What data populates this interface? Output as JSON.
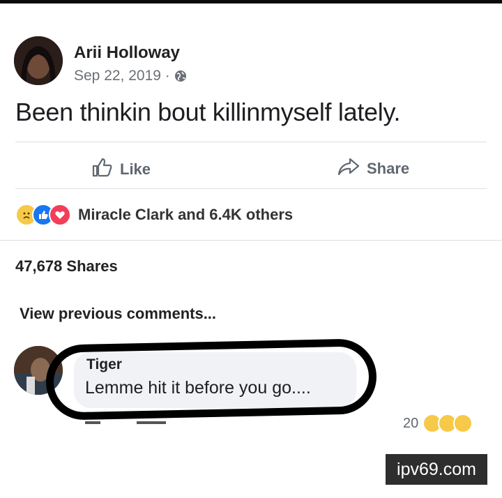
{
  "post": {
    "author": "Arii Holloway",
    "date": "Sep 22, 2019 ·",
    "privacy_icon": "globe-icon",
    "text": "Been thinkin bout killinmyself lately."
  },
  "actions": {
    "like_label": "Like",
    "share_label": "Share"
  },
  "reactions": {
    "icons": [
      "sad-reaction-icon",
      "like-reaction-icon",
      "love-reaction-icon"
    ],
    "summary": "Miracle Clark and 6.4K others"
  },
  "shares_count": "47,678 Shares",
  "comments": {
    "view_previous": "View previous comments...",
    "items": [
      {
        "author": "Tiger",
        "text": "Lemme hit it before you go....",
        "reaction_count": "20"
      }
    ]
  },
  "watermark": "ipv69.com",
  "colors": {
    "text_primary": "#1c1e21",
    "text_secondary": "#606770",
    "bubble_bg": "#f0f2f5",
    "like_blue": "#1877f2",
    "love_red": "#f33e58",
    "sad_yellow": "#f7c948"
  }
}
